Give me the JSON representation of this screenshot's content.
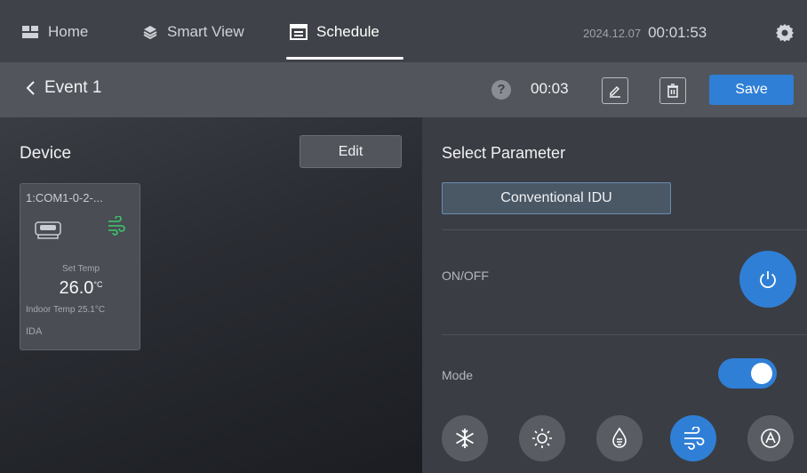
{
  "nav": {
    "items": [
      {
        "label": "Home",
        "icon": "home-icon"
      },
      {
        "label": "Smart View",
        "icon": "smart-view-icon"
      },
      {
        "label": "Schedule",
        "icon": "schedule-icon",
        "active": true
      }
    ],
    "date": "2024.12.07",
    "time": "00:01:53",
    "settings_icon": "gear-icon"
  },
  "subheader": {
    "back_label": "Event 1",
    "duration": "00:03",
    "save_label": "Save"
  },
  "device_panel": {
    "title": "Device",
    "edit_label": "Edit",
    "card": {
      "name": "1:COM1-0-2-...",
      "set_temp_label": "Set Temp",
      "set_temp": "26.0",
      "temp_unit": "°C",
      "indoor_temp_label": "Indoor Temp",
      "indoor_temp": "25.1°C",
      "tag": "IDA"
    }
  },
  "param_panel": {
    "title": "Select Parameter",
    "selected_param": "Conventional IDU",
    "onoff_label": "ON/OFF",
    "mode_label": "Mode",
    "mode_enabled": true,
    "modes": [
      {
        "icon": "snowflake-icon",
        "name": "Cool"
      },
      {
        "icon": "sun-icon",
        "name": "Heat"
      },
      {
        "icon": "droplet-icon",
        "name": "Dry"
      },
      {
        "icon": "fan-icon",
        "name": "Fan",
        "active": true
      },
      {
        "icon": "auto-icon",
        "name": "Auto"
      }
    ]
  },
  "colors": {
    "accent": "#2f7fd6",
    "topbar": "#3f4248",
    "subbar": "#52565c",
    "fan_green": "#3dbb6a"
  }
}
